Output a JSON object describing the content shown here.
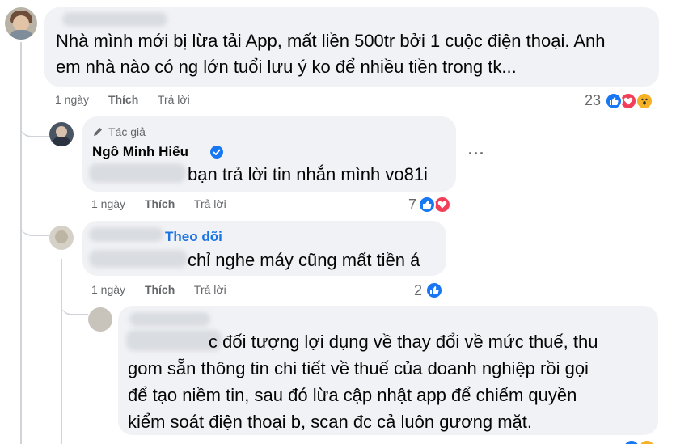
{
  "comments": [
    {
      "text_line1": "Nhà mình mới bị lừa tải App, mất liền 500tr bởi 1 cuộc điện thoại. Anh",
      "text_line2": "em nhà nào có ng lớn tuổi lưu ý ko để nhiều tiền trong tk...",
      "time": "1 ngày",
      "like_label": "Thích",
      "reply_label": "Trả lời",
      "reaction_count": "23",
      "reactions": [
        "like-icon",
        "love-icon",
        "wow-icon"
      ]
    },
    {
      "author_tag": "Tác giả",
      "author_name": "Ngô Minh Hiếu",
      "text": "bạn trả lời tin nhắn mình vo81i",
      "time": "1 ngày",
      "like_label": "Thích",
      "reply_label": "Trả lời",
      "reaction_count": "7",
      "reactions": [
        "like-icon",
        "love-icon"
      ],
      "more_label": "···"
    },
    {
      "follow_label": "Theo dõi",
      "text": "chỉ nghe máy cũng mất tiền á",
      "time": "1 ngày",
      "like_label": "Thích",
      "reply_label": "Trả lời",
      "reaction_count": "2",
      "reactions": [
        "like-icon"
      ]
    },
    {
      "text_line1": "c đối tượng lợi dụng về thay đổi về mức thuế, thu",
      "text_line2": "gom sẵn thông tin chi tiết về thuế của doanh nghiệp rồi gọi",
      "text_line3": "để tạo niềm tin, sau đó lừa cập nhật app để chiếm quyền",
      "text_line4": "kiểm soát điện thoại b, scan đc cả luôn gương mặt."
    }
  ],
  "colors": {
    "bubble": "#f0f2f5",
    "link": "#1b74e4",
    "meta": "#65676b",
    "like": "#1877f2",
    "love": "#f33e58",
    "wow": "#f7b125"
  }
}
